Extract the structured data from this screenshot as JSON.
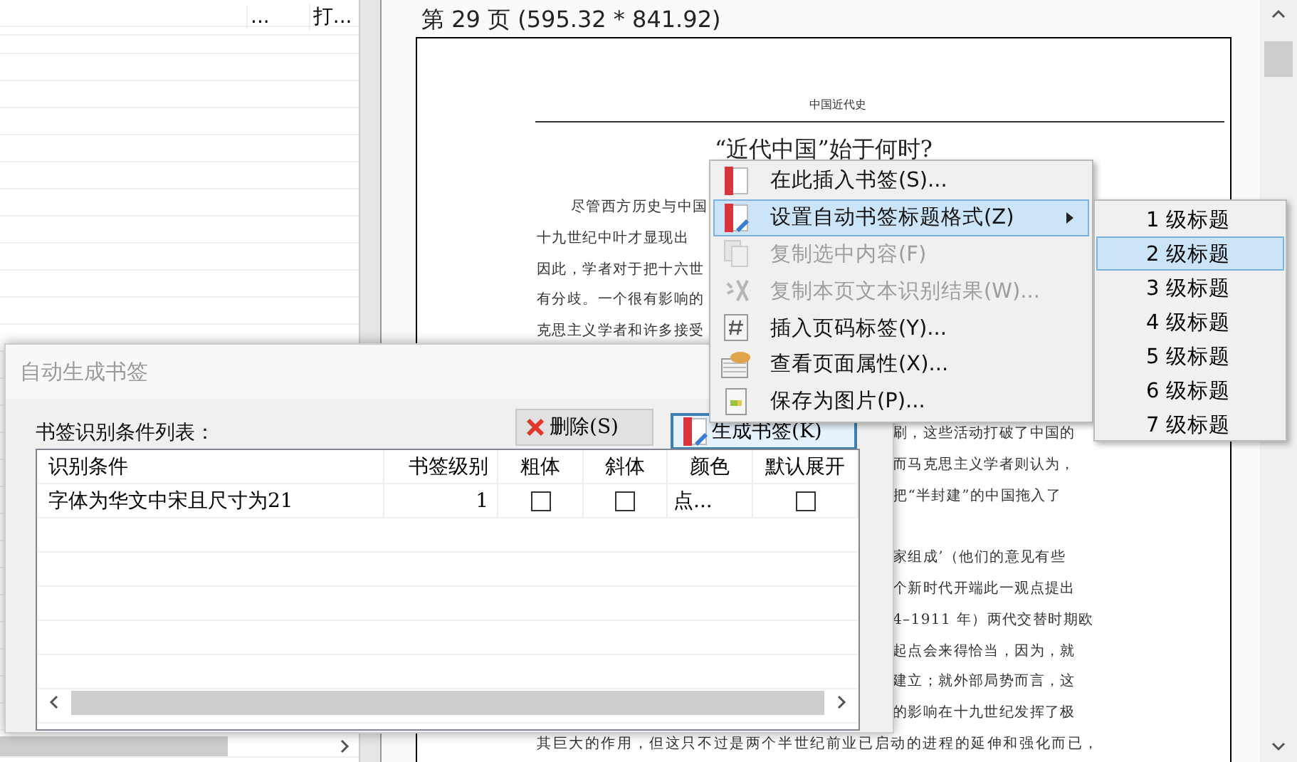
{
  "list_panel": {
    "columns": [
      "...",
      "打..."
    ]
  },
  "page": {
    "caption": "第 29 页 (595.32 * 841.92)",
    "header": "中国近代史",
    "title": "“近代中国”始于何时?",
    "top_lines": [
      "尽管西方历史与中国",
      "十九世纪中叶才显现出",
      "因此，学者对于把十六世",
      "有分歧。一个很有影响的",
      "克思主义学者和许多接受"
    ],
    "right_lines": [
      "刷，这些活动打破了中国的",
      "而马克思主义学者则认为，",
      "把“半封建”的中国拖入了"
    ],
    "right_lines_2": [
      "家组成’（他们的意见有些",
      "个新时代开端此一观点提出",
      "4–1911 年）两代交替时期欧",
      "起点会来得恰当，因为，就",
      "建立；就外部局势而言，这",
      "的影响在十九世纪发挥了极"
    ],
    "bottom_line": "其巨大的作用，但这只不过是两个半世纪前业已启动的进程的延伸和强化而已，"
  },
  "dialog": {
    "title": "自动生成书签",
    "list_label": "书签识别条件列表：",
    "buttons": [
      {
        "label": "删除(S)",
        "kind": "delete",
        "focused": false
      },
      {
        "label": "生成书签(K)",
        "kind": "generate",
        "focused": true
      }
    ],
    "table": {
      "columns": [
        "识别条件",
        "书签级别",
        "粗体",
        "斜体",
        "颜色",
        "默认展开"
      ],
      "rows": [
        {
          "condition": "字体为华文中宋且尺寸为21",
          "level": "1",
          "bold": false,
          "italic": false,
          "color_label": "点...",
          "expanded": false
        }
      ]
    }
  },
  "context_menu": {
    "items": [
      {
        "label": "在此插入书签(S)...",
        "kind": "bookmark",
        "selected": false,
        "disabled": false,
        "submenu": false
      },
      {
        "label": "设置自动书签标题格式(Z)",
        "kind": "bookmark-edit",
        "selected": true,
        "disabled": false,
        "submenu": true
      },
      {
        "label": "复制选中内容(F)",
        "kind": "copy",
        "selected": false,
        "disabled": true,
        "submenu": false
      },
      {
        "label": "复制本页文本识别结果(W)...",
        "kind": "text",
        "selected": false,
        "disabled": true,
        "submenu": false
      },
      {
        "label": "插入页码标签(Y)...",
        "kind": "page-number",
        "selected": false,
        "disabled": false,
        "submenu": false
      },
      {
        "label": "查看页面属性(X)...",
        "kind": "properties",
        "selected": false,
        "disabled": false,
        "submenu": false
      },
      {
        "label": "保存为图片(P)...",
        "kind": "image",
        "selected": false,
        "disabled": false,
        "submenu": false
      }
    ]
  },
  "submenu": {
    "items": [
      {
        "label": "1 级标题",
        "selected": false
      },
      {
        "label": "2 级标题",
        "selected": true
      },
      {
        "label": "3 级标题",
        "selected": false
      },
      {
        "label": "4 级标题",
        "selected": false
      },
      {
        "label": "5 级标题",
        "selected": false
      },
      {
        "label": "6 级标题",
        "selected": false
      },
      {
        "label": "7 级标题",
        "selected": false
      }
    ]
  }
}
